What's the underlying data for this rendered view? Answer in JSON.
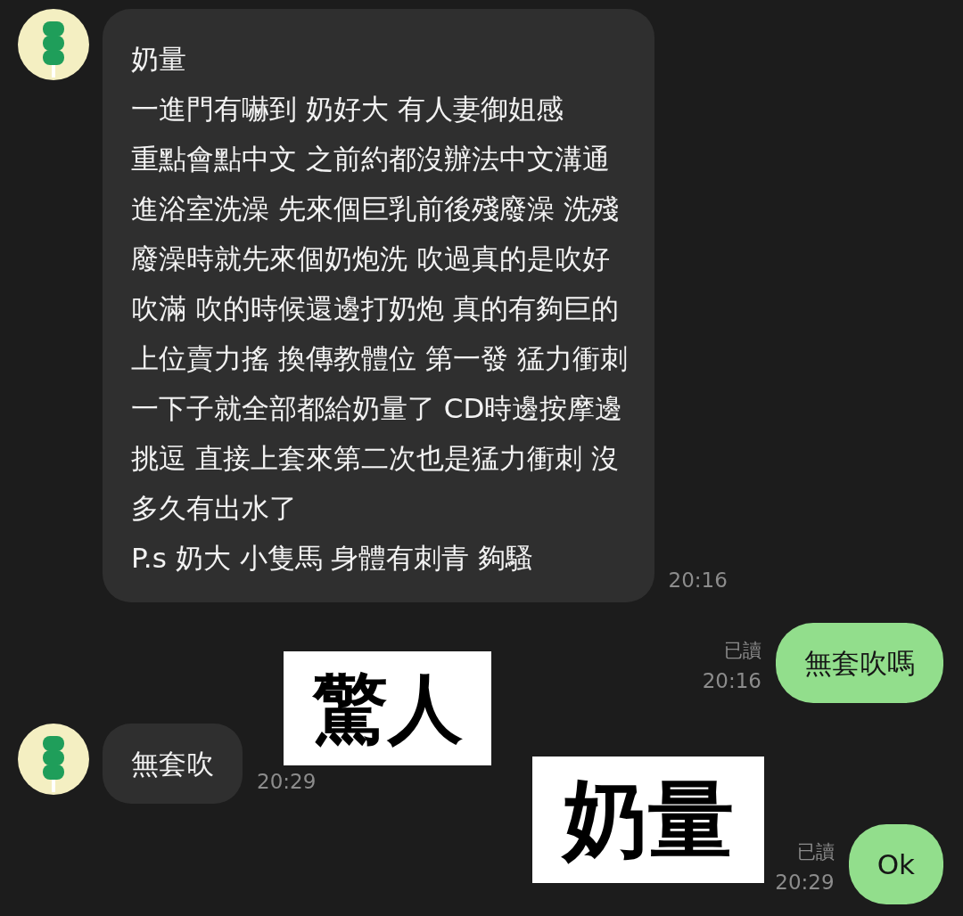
{
  "messages": [
    {
      "kind": "incoming",
      "lines": [
        "奶量",
        "一進門有嚇到 奶好大 有人妻御姐感",
        "重點會點中文 之前約都沒辦法中文溝通",
        "進浴室洗澡 先來個巨乳前後殘廢澡 洗殘",
        "廢澡時就先來個奶炮洗 吹過真的是吹好",
        "吹滿 吹的時候還邊打奶炮 真的有夠巨的",
        "上位賣力搖 換傳教體位 第一發 猛力衝刺",
        "一下子就全部都給奶量了 CD時邊按摩邊",
        "挑逗 直接上套來第二次也是猛力衝刺 沒",
        "多久有出水了",
        "P.s 奶大 小隻馬 身體有刺青 夠騷"
      ],
      "time": "20:16"
    },
    {
      "kind": "outgoing",
      "read_label": "已讀",
      "time": "20:16",
      "lines": [
        "無套吹嗎"
      ]
    },
    {
      "kind": "sticker",
      "text": "驚人"
    },
    {
      "kind": "incoming",
      "lines": [
        "無套吹"
      ],
      "time": "20:29"
    },
    {
      "kind": "sticker",
      "text": "奶量"
    },
    {
      "kind": "outgoing",
      "read_label": "已讀",
      "time": "20:29",
      "lines": [
        "Ok"
      ]
    }
  ]
}
